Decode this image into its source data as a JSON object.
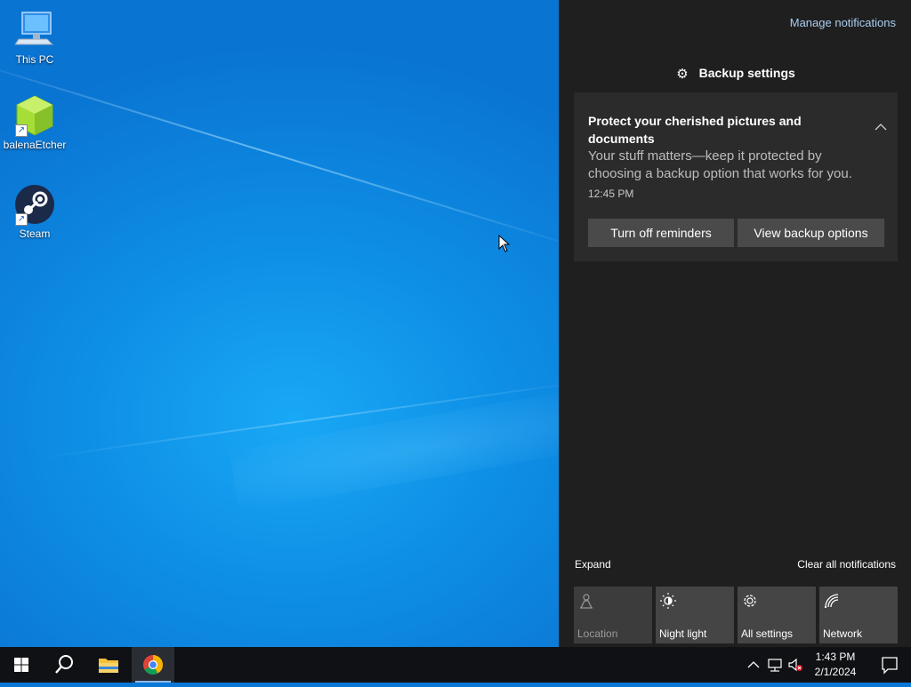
{
  "desktop": {
    "icons": [
      {
        "label": "This PC",
        "icon": "computer-icon"
      },
      {
        "label": "balenaEtcher",
        "icon": "balena-etcher-icon"
      },
      {
        "label": "Steam",
        "icon": "steam-icon"
      }
    ]
  },
  "action_center": {
    "manage_notifications": "Manage notifications",
    "group_title": "Backup settings",
    "group_icon": "gear-icon",
    "notification": {
      "title": "Protect your cherished pictures and documents",
      "body": "Your stuff matters—keep it protected by choosing a backup option that works for you.",
      "time": "12:45 PM",
      "buttons": [
        "Turn off reminders",
        "View backup options"
      ]
    },
    "expand_label": "Expand",
    "clear_all_label": "Clear all notifications",
    "quick_actions": [
      {
        "label": "Location",
        "icon": "location-icon",
        "enabled": false
      },
      {
        "label": "Night light",
        "icon": "night-light-icon",
        "enabled": true
      },
      {
        "label": "All settings",
        "icon": "gear-icon",
        "enabled": true
      },
      {
        "label": "Network",
        "icon": "network-icon",
        "enabled": true
      }
    ]
  },
  "taskbar": {
    "pinned": [
      "start-icon",
      "search-icon",
      "file-explorer-icon",
      "chrome-icon"
    ],
    "tray": [
      "chevron-up-icon",
      "network-icon",
      "volume-muted-icon"
    ],
    "clock": {
      "time": "1:43 PM",
      "date": "2/1/2024"
    },
    "accent": "#8fb8ea"
  },
  "colors": {
    "panel_bg": "#1f1f1f",
    "toast_bg": "#2b2b2b",
    "button_bg": "#4a4a4a",
    "link": "#a9cdf0"
  }
}
